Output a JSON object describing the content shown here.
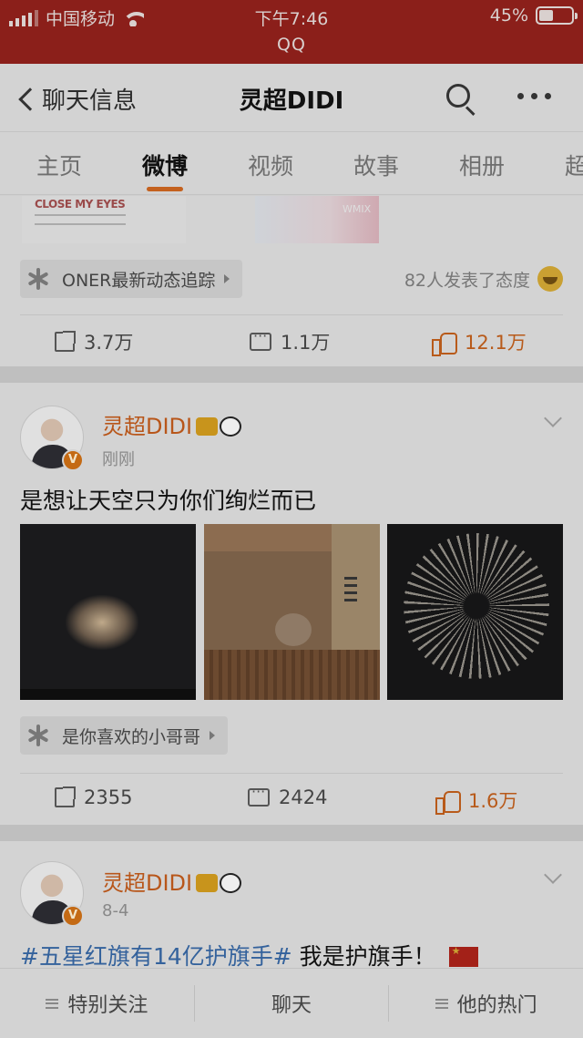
{
  "status_bar": {
    "carrier": "中国移动",
    "time": "下午7:46",
    "battery": "45%",
    "battery_level": 0.45,
    "app_label": "QQ"
  },
  "nav": {
    "back_label": "聊天信息",
    "title": "灵超DIDI"
  },
  "tabs": [
    "主页",
    "微博",
    "视频",
    "故事",
    "相册",
    "超"
  ],
  "active_tab": "微博",
  "post_top": {
    "image_texts": [
      "CLOSE MY EYES",
      "WMIX"
    ],
    "tag": "ONER最新动态追踪",
    "attitude_text": "82人发表了态度",
    "shares": "3.7万",
    "comments": "1.1万",
    "likes": "12.1万"
  },
  "post_2": {
    "author": "灵超DIDI",
    "time": "刚刚",
    "text": "是想让天空只为你们绚烂而已",
    "tag": "是你喜欢的小哥哥",
    "shares": "2355",
    "comments": "2424",
    "likes": "1.6万"
  },
  "post_3": {
    "author": "灵超DIDI",
    "time": "8-4",
    "hashtag": "#五星红旗有14亿护旗手#",
    "text": " 我是护旗手！"
  },
  "verified_mark": "V",
  "bottom_bar": [
    "特别关注",
    "聊天",
    "他的热门"
  ],
  "colors": {
    "status_bar": "#8b1f1a",
    "accent_orange": "#c4611e",
    "like_orange": "#b85a1a",
    "hashtag_blue": "#34629c"
  }
}
